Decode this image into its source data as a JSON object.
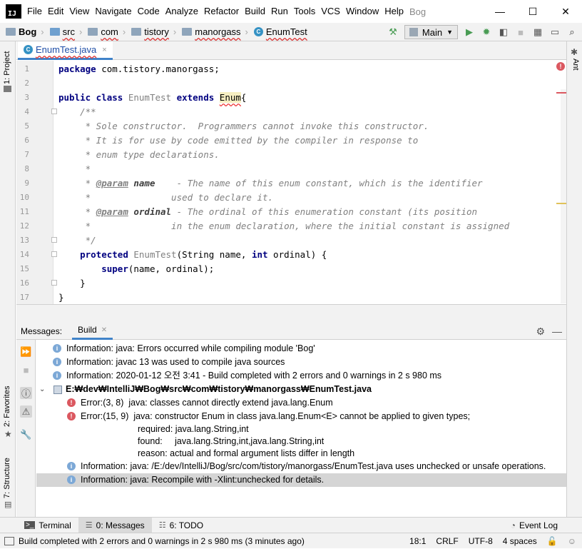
{
  "app": {
    "logo": "IJ",
    "project_name": "Bog"
  },
  "menu": [
    "File",
    "Edit",
    "View",
    "Navigate",
    "Code",
    "Analyze",
    "Refactor",
    "Build",
    "Run",
    "Tools",
    "VCS",
    "Window",
    "Help"
  ],
  "window_controls": {
    "minimize": "—",
    "maximize": "☐",
    "close": "✕"
  },
  "breadcrumbs": [
    "Bog",
    "src",
    "com",
    "tistory",
    "manorgass",
    "EnumTest"
  ],
  "toolbar": {
    "run_config": "Main",
    "dropdown_icon": "chevron-down-icon"
  },
  "editor_tab": {
    "label": "EnumTest.java",
    "close": "×"
  },
  "left_tabs": {
    "project": "1: Project",
    "favorites": "2: Favorites",
    "structure": "7: Structure"
  },
  "right_tabs": {
    "ant": "Ant"
  },
  "editor": {
    "line_numbers": [
      "1",
      "2",
      "3",
      "4",
      "5",
      "6",
      "7",
      "8",
      "9",
      "10",
      "11",
      "12",
      "13",
      "14",
      "15",
      "16",
      "17"
    ],
    "lines": {
      "l1_kw": "package",
      "l1_rest": " com.tistory.manorgass;",
      "l3_kw1": "public class",
      "l3_name": " EnumTest ",
      "l3_kw2": "extends",
      "l3_sp": " ",
      "l3_enum": "Enum",
      "l3_brace": "{",
      "l4": "    /**",
      "l5": "     * Sole constructor.  Programmers cannot invoke this constructor.",
      "l6": "     * It is for use by code emitted by the compiler in response to",
      "l7": "     * enum type declarations.",
      "l8": "     *",
      "l9_pre": "     * ",
      "l9_tag": "@param",
      "l9_sp": " ",
      "l9_name": "name",
      "l9_rest": "    - The name of this enum constant, which is the identifier",
      "l10": "     *               used to declare it.",
      "l11_pre": "     * ",
      "l11_tag": "@param",
      "l11_sp": " ",
      "l11_name": "ordinal",
      "l11_rest": " - The ordinal of this enumeration constant (its position",
      "l12": "     *               in the enum declaration, where the initial constant is assigned",
      "l13": "     */",
      "l14_ind": "    ",
      "l14_kw": "protected",
      "l14_name": " EnumTest",
      "l14_a": "(String name, ",
      "l14_int": "int",
      "l14_b": " ordinal) {",
      "l15_ind": "        ",
      "l15_kw": "super",
      "l15_rest": "(name, ordinal);",
      "l16": "    }",
      "l17": "}"
    }
  },
  "messages": {
    "label": "Messages:",
    "tab": "Build",
    "rows": [
      {
        "type": "info",
        "text": "Information: java: Errors occurred while compiling module 'Bog'"
      },
      {
        "type": "info",
        "text": "Information: javac 13 was used to compile java sources"
      },
      {
        "type": "info",
        "text": "Information: 2020-01-12 오전 3:41 - Build completed with 2 errors and 0 warnings in 2 s 980 ms"
      },
      {
        "type": "file",
        "text": "E:₩dev₩IntelliJ₩Bog₩src₩com₩tistory₩manorgass₩EnumTest.java"
      },
      {
        "type": "err",
        "text": "Error:(3, 8)  java: classes cannot directly extend java.lang.Enum"
      },
      {
        "type": "err",
        "text": "Error:(15, 9)  java: constructor Enum in class java.lang.Enum<E> cannot be applied to given types;"
      },
      {
        "type": "cont",
        "text": "required: java.lang.String,int"
      },
      {
        "type": "cont",
        "text": "found:     java.lang.String,int,java.lang.String,int"
      },
      {
        "type": "cont",
        "text": "reason: actual and formal argument lists differ in length"
      },
      {
        "type": "info",
        "text": "Information: java: /E:/dev/IntelliJ/Bog/src/com/tistory/manorgass/EnumTest.java uses unchecked or unsafe operations."
      },
      {
        "type": "info",
        "text": "Information: java: Recompile with -Xlint:unchecked for details."
      }
    ]
  },
  "bottom_tabs": {
    "terminal": "Terminal",
    "messages": "0: Messages",
    "todo": "6: TODO",
    "event_log": "Event Log"
  },
  "status": {
    "message": "Build completed with 2 errors and 0 warnings in 2 s 980 ms (3 minutes ago)",
    "position": "18:1",
    "line_sep": "CRLF",
    "encoding": "UTF-8",
    "indent": "4 spaces"
  },
  "colors": {
    "accent": "#4083c9",
    "error": "#db5860",
    "info": "#7ca8d6",
    "keyword": "#000080",
    "comment": "#808080"
  }
}
